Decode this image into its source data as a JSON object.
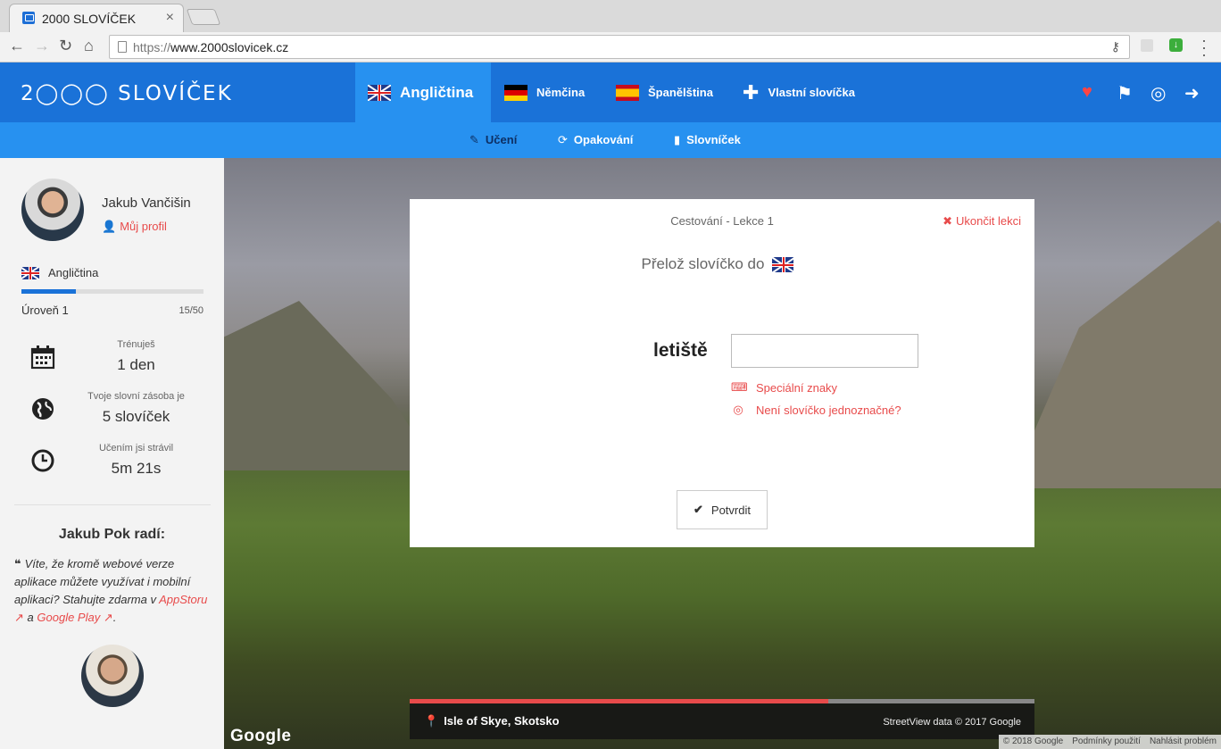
{
  "browser": {
    "tab_title": "2000 SLOVÍČEK",
    "url_prefix": "https://",
    "url_host": "www.2000slovicek.cz"
  },
  "header": {
    "logo": "2◯◯◯ SLOVÍČEK",
    "lang_tabs": [
      {
        "label": "Angličtina",
        "flag": "uk"
      },
      {
        "label": "Němčina",
        "flag": "de"
      },
      {
        "label": "Španělština",
        "flag": "es"
      },
      {
        "label": "Vlastní slovíčka",
        "icon": "plus-icon"
      }
    ],
    "right_icons": [
      "heart-icon",
      "flag-icon",
      "lifebuoy-icon",
      "logout-icon"
    ]
  },
  "subnav": {
    "items": [
      {
        "label": "Učení",
        "icon": "edit-icon"
      },
      {
        "label": "Opakování",
        "icon": "refresh-icon"
      },
      {
        "label": "Slovníček",
        "icon": "bookmark-icon"
      }
    ]
  },
  "sidebar": {
    "user_name": "Jakub Vančišin",
    "profile_link": "Můj profil",
    "language": "Angličtina",
    "level_label": "Úroveň 1",
    "level_count": "15/50",
    "level_progress": 0.3,
    "stats": [
      {
        "label": "Trénuješ",
        "value": "1 den",
        "icon": "calendar-icon"
      },
      {
        "label": "Tvoje slovní zásoba je",
        "value": "5 slovíček",
        "icon": "globe-icon"
      },
      {
        "label": "Učením jsi strávil",
        "value": "5m 21s",
        "icon": "clock-icon"
      }
    ],
    "tip_title": "Jakub Pok radí:",
    "tip_text_1": "Víte, že kromě webové verze aplikace můžete využívat i mobilní aplikaci? Stahujte zdarma v",
    "tip_link_1": "AppStoru",
    "tip_and": "a",
    "tip_link_2": "Google Play",
    "tip_end": "."
  },
  "lesson": {
    "title": "Cestování - Lekce 1",
    "end_label": "Ukončit lekci",
    "instruction": "Přelož slovíčko do",
    "word": "letiště",
    "answer_value": "",
    "special_chars": "Speciální znaky",
    "ambiguous": "Není slovíčko jednoznačné?",
    "confirm_label": "Potvrdit",
    "progress": 0.67
  },
  "map": {
    "location": "Isle of Skye, Skotsko",
    "credit": "StreetView data © 2017 Google",
    "google_logo": "Google",
    "links": [
      "© 2018 Google",
      "Podmínky použití",
      "Nahlásit problém"
    ]
  }
}
